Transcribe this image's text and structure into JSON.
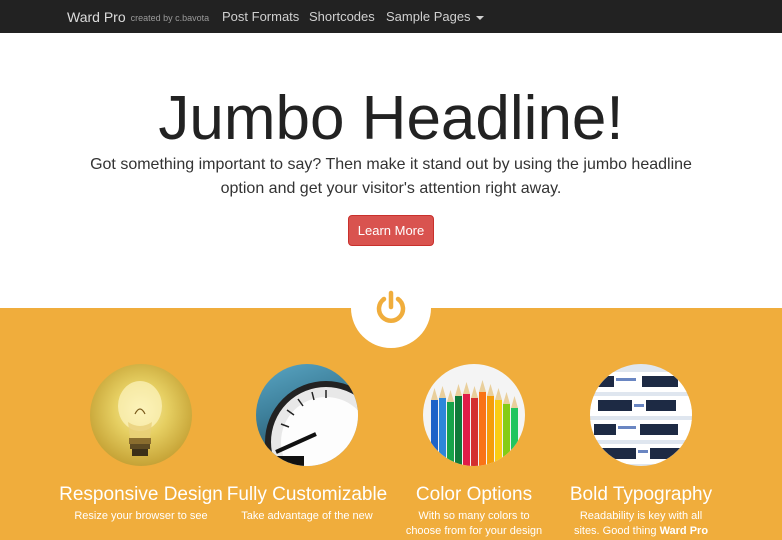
{
  "navbar": {
    "brand": "Ward Pro",
    "credit": "created by c.bavota",
    "items": [
      {
        "label": "Post Formats"
      },
      {
        "label": "Shortcodes"
      },
      {
        "label": "Sample Pages"
      }
    ]
  },
  "jumbo": {
    "headline": "Jumbo Headline!",
    "subtext": "Got something important to say? Then make it stand out by using the jumbo headline option and get your visitor's attention right away.",
    "button": "Learn More"
  },
  "features": [
    {
      "title": "Responsive Design",
      "text": "Resize your browser to see",
      "icon": "lightbulb-image"
    },
    {
      "title": "Fully Customizable",
      "text": "Take advantage of the new",
      "icon": "dial-image"
    },
    {
      "title": "Color Options",
      "text": "With so many colors to choose from for your design",
      "icon": "color-pencils-image"
    },
    {
      "title": "Bold Typography",
      "text_pre": "Readability is key with all sites. Good thing",
      "text_bold": "Ward Pro",
      "icon": "typography-image"
    }
  ],
  "colors": {
    "navbar": "#222222",
    "accent": "#f0ad3c",
    "button": "#d9534f"
  }
}
